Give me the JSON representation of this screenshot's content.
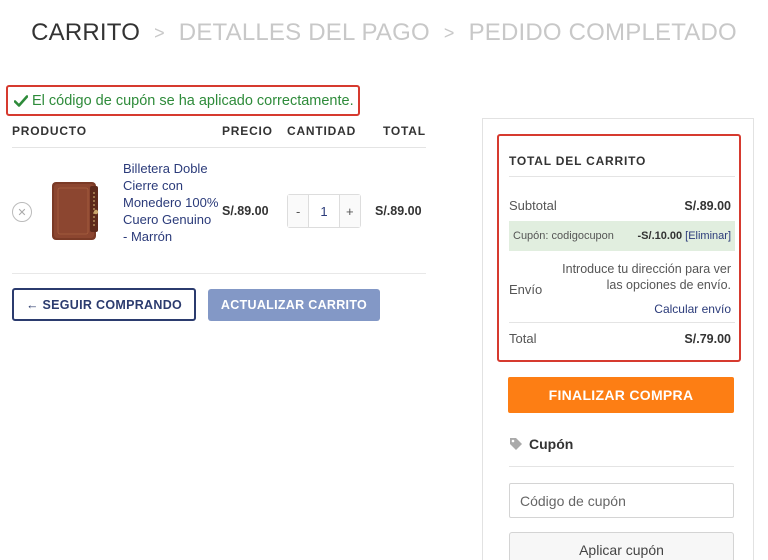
{
  "steps": {
    "cart": "CARRITO",
    "payment": "DETALLES DEL PAGO",
    "complete": "PEDIDO COMPLETADO",
    "separator": ">"
  },
  "notice": {
    "message": "El código de cupón se ha aplicado correctamente.",
    "color": "#2e8b3a"
  },
  "table": {
    "headers": {
      "product": "PRODUCTO",
      "price": "PRECIO",
      "quantity": "CANTIDAD",
      "total": "TOTAL"
    },
    "rows": [
      {
        "name": "Billetera Doble Cierre con Monedero 100% Cuero Genuino - Marrón",
        "price": "S/.89.00",
        "quantity": "1",
        "total": "S/.89.00"
      }
    ],
    "qty_minus": "-",
    "qty_plus": "+"
  },
  "actions": {
    "continue_shopping": "← SEGUIR COMPRANDO",
    "update_cart": "ACTUALIZAR CARRITO"
  },
  "totals": {
    "title": "TOTAL DEL CARRITO",
    "subtotal_label": "Subtotal",
    "subtotal_value": "S/.89.00",
    "coupon_label": "Cupón: codigocupon",
    "coupon_value": "-S/.10.00",
    "coupon_remove": "[Eliminar]",
    "shipping_label": "Envío",
    "shipping_text": "Introduce tu dirección para ver las opciones de envío.",
    "shipping_link": "Calcular envío",
    "total_label": "Total",
    "total_value": "S/.79.00"
  },
  "checkout": {
    "button": "FINALIZAR COMPRA",
    "color": "#fd7e14"
  },
  "coupon": {
    "heading": "Cupón",
    "placeholder": "Código de cupón",
    "apply": "Aplicar cupón"
  }
}
